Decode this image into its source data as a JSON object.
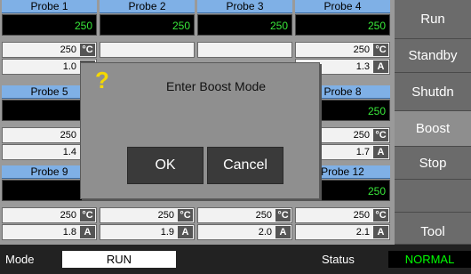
{
  "probes": [
    {
      "title": "Probe 1",
      "display": "250",
      "temp": "250",
      "temp_unit": "°C",
      "amps": "1.0",
      "amps_unit": "A"
    },
    {
      "title": "Probe 2",
      "display": "250",
      "temp": "",
      "temp_unit": "",
      "amps": "",
      "amps_unit": ""
    },
    {
      "title": "Probe 3",
      "display": "250",
      "temp": "",
      "temp_unit": "",
      "amps": "",
      "amps_unit": ""
    },
    {
      "title": "Probe 4",
      "display": "250",
      "temp": "250",
      "temp_unit": "°C",
      "amps": "1.3",
      "amps_unit": "A"
    },
    {
      "title": "Probe 5",
      "display": "",
      "temp": "250",
      "temp_unit": "",
      "amps": "1.4",
      "amps_unit": ""
    },
    {
      "title": "",
      "display": "",
      "temp": "",
      "temp_unit": "",
      "amps": "",
      "amps_unit": ""
    },
    {
      "title": "",
      "display": "",
      "temp": "",
      "temp_unit": "",
      "amps": "",
      "amps_unit": ""
    },
    {
      "title": "Probe 8",
      "display": "250",
      "temp": "250",
      "temp_unit": "°C",
      "amps": "1.7",
      "amps_unit": "A"
    },
    {
      "title": "Probe 9",
      "display": "",
      "temp": "250",
      "temp_unit": "°C",
      "amps": "1.8",
      "amps_unit": "A"
    },
    {
      "title": "",
      "display": "",
      "temp": "250",
      "temp_unit": "°C",
      "amps": "1.9",
      "amps_unit": "A"
    },
    {
      "title": "",
      "display": "",
      "temp": "250",
      "temp_unit": "°C",
      "amps": "2.0",
      "amps_unit": "A"
    },
    {
      "title": "Probe 12",
      "display": "250",
      "temp": "250",
      "temp_unit": "°C",
      "amps": "2.1",
      "amps_unit": "A"
    }
  ],
  "sidebar": {
    "run": "Run",
    "standby": "Standby",
    "shutdown": "Shutdn",
    "boost": "Boost",
    "stop": "Stop",
    "tool": "Tool"
  },
  "status_bar": {
    "mode_label": "Mode",
    "mode_value": "RUN",
    "status_label": "Status",
    "status_value": "NORMAL"
  },
  "dialog": {
    "icon": "?",
    "message": "Enter Boost Mode",
    "ok": "OK",
    "cancel": "Cancel"
  },
  "colors": {
    "probe_header": "#7fb0e6",
    "display_text": "#39e83a",
    "status_normal": "#00ff00",
    "question_icon": "#f5d800"
  }
}
